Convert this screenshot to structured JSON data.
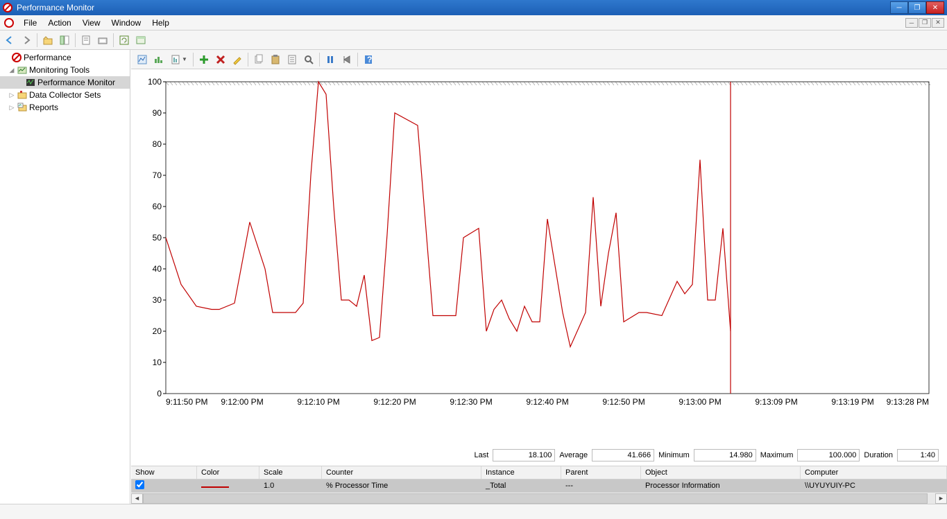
{
  "window": {
    "title": "Performance Monitor"
  },
  "menubar": {
    "file": "File",
    "action": "Action",
    "view": "View",
    "window": "Window",
    "help": "Help"
  },
  "tree": {
    "root": "Performance",
    "monitoring": "Monitoring Tools",
    "perfmon": "Performance Monitor",
    "collector": "Data Collector Sets",
    "reports": "Reports"
  },
  "stats": {
    "last_label": "Last",
    "last": "18.100",
    "avg_label": "Average",
    "avg": "41.666",
    "min_label": "Minimum",
    "min": "14.980",
    "max_label": "Maximum",
    "max": "100.000",
    "dur_label": "Duration",
    "dur": "1:40"
  },
  "grid": {
    "headers": {
      "show": "Show",
      "color": "Color",
      "scale": "Scale",
      "counter": "Counter",
      "instance": "Instance",
      "parent": "Parent",
      "object": "Object",
      "computer": "Computer"
    },
    "row": {
      "show": true,
      "scale": "1.0",
      "counter": "% Processor Time",
      "instance": "_Total",
      "parent": "---",
      "object": "Processor Information",
      "computer": "\\\\UYUYUIY-PC"
    }
  },
  "chart_data": {
    "type": "line",
    "ylim": [
      0,
      100
    ],
    "yticks": [
      0,
      10,
      20,
      30,
      40,
      50,
      60,
      70,
      80,
      90,
      100
    ],
    "xticks": [
      "9:11:50 PM",
      "9:12:00 PM",
      "9:12:10 PM",
      "9:12:20 PM",
      "9:12:30 PM",
      "9:12:40 PM",
      "9:12:50 PM",
      "9:13:00 PM",
      "9:13:09 PM",
      "9:13:19 PM",
      "9:13:28 PM"
    ],
    "cursor_x": 74,
    "series": [
      {
        "name": "% Processor Time",
        "color": "#c00000",
        "x": [
          0,
          2,
          4,
          6,
          7,
          9,
          11,
          13,
          14,
          15,
          16,
          17,
          18,
          19,
          20,
          21,
          22,
          23,
          24,
          25,
          26,
          27,
          28,
          29,
          30,
          33,
          35,
          36,
          38,
          39,
          41,
          42,
          43,
          44,
          45,
          46,
          47,
          48,
          49,
          50,
          52,
          53,
          55,
          56,
          57,
          58,
          59,
          60,
          62,
          63,
          65,
          67,
          68,
          69,
          70,
          71,
          72,
          73,
          74
        ],
        "y": [
          50,
          35,
          28,
          27,
          27,
          29,
          55,
          40,
          26,
          26,
          26,
          26,
          29,
          70,
          100,
          96,
          60,
          30,
          30,
          28,
          38,
          17,
          18,
          51,
          90,
          86,
          25,
          25,
          25,
          50,
          53,
          20,
          27,
          30,
          24,
          20,
          28,
          23,
          23,
          56,
          26,
          15,
          26,
          63,
          28,
          45,
          58,
          23,
          26,
          26,
          25,
          36,
          32,
          35,
          75,
          30,
          30,
          53,
          20
        ]
      }
    ]
  }
}
